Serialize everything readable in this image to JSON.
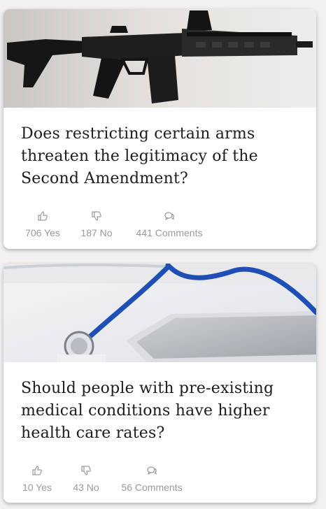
{
  "cards": [
    {
      "title": "Does restricting certain arms threaten the legitimacy of the Second Amendment?",
      "image_icon": "rifle-photo",
      "yes": "706 Yes",
      "no": "187 No",
      "comments": "441 Comments"
    },
    {
      "title": "Should people with pre-existing medical conditions have higher health care rates?",
      "image_icon": "stethoscope-phone-photo",
      "yes": "10 Yes",
      "no": "43 No",
      "comments": "56 Comments"
    }
  ],
  "colors": {
    "background": "#f2f0f1",
    "card": "#ffffff",
    "title_text": "#1c1c1c",
    "stat_text": "#9a9a9a",
    "stethoscope_tube": "#1f4fb5"
  },
  "icons": {
    "yes": "thumbs-up-icon",
    "no": "thumbs-down-icon",
    "comments": "comment-bubbles-icon"
  }
}
